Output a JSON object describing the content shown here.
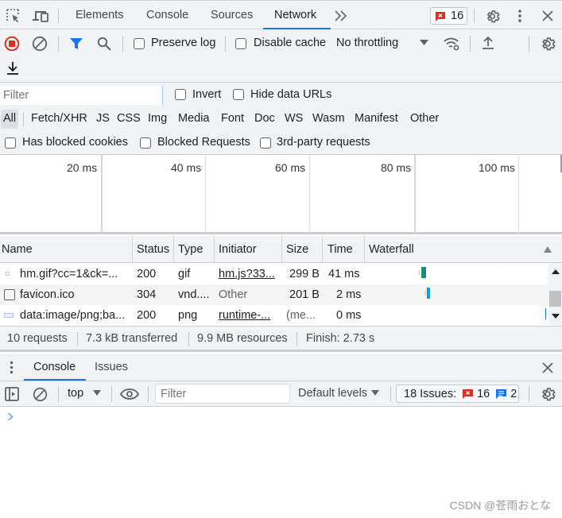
{
  "main_tabs": {
    "items": [
      {
        "label": "Elements",
        "active": false
      },
      {
        "label": "Console",
        "active": false
      },
      {
        "label": "Sources",
        "active": false
      },
      {
        "label": "Network",
        "active": true
      }
    ],
    "more_tabs_icon": "chevrons-right-icon",
    "error_badge_count": "16"
  },
  "network_toolbar": {
    "preserve_log_label": "Preserve log",
    "preserve_log_checked": false,
    "disable_cache_label": "Disable cache",
    "disable_cache_checked": false,
    "throttling_value": "No throttling"
  },
  "filter_bar": {
    "filter_placeholder": "Filter",
    "invert_label": "Invert",
    "hide_data_urls_label": "Hide data URLs",
    "type_filters": [
      "All",
      "Fetch/XHR",
      "JS",
      "CSS",
      "Img",
      "Media",
      "Font",
      "Doc",
      "WS",
      "Wasm",
      "Manifest",
      "Other"
    ],
    "active_type": "All",
    "has_blocked_cookies_label": "Has blocked cookies",
    "blocked_requests_label": "Blocked Requests",
    "third_party_label": "3rd-party requests"
  },
  "overview": {
    "ticks": [
      "20 ms",
      "40 ms",
      "60 ms",
      "80 ms",
      "100 ms"
    ]
  },
  "table": {
    "columns": [
      "Name",
      "Status",
      "Type",
      "Initiator",
      "Size",
      "Time",
      "Waterfall"
    ],
    "rows": [
      {
        "name": "hm.gif?cc=1&ck=...",
        "status": "200",
        "type": "gif",
        "initiator": "hm.js?33...",
        "initiator_link": true,
        "size": "299 B",
        "time": "41 ms"
      },
      {
        "name": "favicon.ico",
        "status": "304",
        "type": "vnd....",
        "initiator": "Other",
        "initiator_link": false,
        "size": "201 B",
        "time": "2 ms"
      },
      {
        "name": "data:image/png;ba...",
        "status": "200",
        "type": "png",
        "initiator": "runtime-...",
        "initiator_link": true,
        "size": "(me...",
        "time": "0 ms"
      }
    ]
  },
  "summary": {
    "requests": "10 requests",
    "transferred": "7.3 kB transferred",
    "resources": "9.9 MB resources",
    "finish": "Finish: 2.73 s"
  },
  "drawer": {
    "tabs": [
      {
        "label": "Console",
        "active": true
      },
      {
        "label": "Issues",
        "active": false
      }
    ]
  },
  "console_toolbar": {
    "context": "top",
    "filter_placeholder": "Filter",
    "levels": "Default levels",
    "issues_label": "18 Issues:",
    "issues_errors": "16",
    "issues_info": "2"
  },
  "watermark": "CSDN @苍雨おとな",
  "colors": {
    "accent": "#1a73e8",
    "error": "#d93025",
    "record": "#d93025"
  }
}
